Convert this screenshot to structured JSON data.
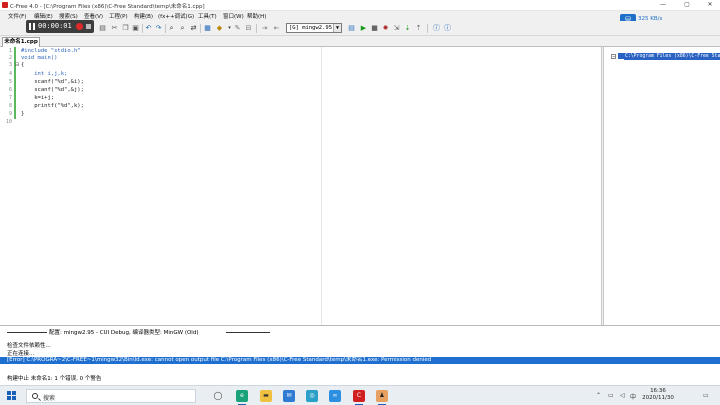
{
  "window": {
    "title": "C-Free 4.0 - [C:\\Program Files (x86)\\C-Free Standard\\temp\\未命名1.cpp]",
    "minimize": "—",
    "maximize": "▢",
    "close": "✕"
  },
  "recording": {
    "time": "00:00:01"
  },
  "network": {
    "speed": "325 KB/s"
  },
  "menu": [
    "文件(F)",
    "编辑(E)",
    "搜索(S)",
    "查看(V)",
    "工程(P)",
    "构建(B)",
    "(fx++调试(G)",
    "工具(T)",
    "窗口(W)",
    "帮助(H)"
  ],
  "toolbar": {
    "compiler": "[G] mingw2.95"
  },
  "tabs": [
    {
      "label": "未命名1.cpp"
    }
  ],
  "editor": {
    "line_numbers": [
      "1",
      "2",
      "3",
      "4",
      "5",
      "6",
      "7",
      "8",
      "9",
      "10"
    ],
    "code": [
      "#include \"stdio.h\"",
      "void main()",
      "{",
      "    int i,j,k;",
      "    scanf(\"%d\",&i);",
      "    scanf(\"%d\",&j);",
      "    k=i+j;",
      "    printf(\"%d\",k);",
      "}",
      ""
    ]
  },
  "project_tree": {
    "root": "C:\\Program Files (x86)\\C-Free Standard\\temp"
  },
  "output": {
    "header": "配置: mingw2.95 - CUI Debug, 编译器类型: MinGW (Old)",
    "lines": [
      "检查文件依赖性...",
      "正在连接..."
    ],
    "error": "[Error] C:\\PROGRA~2\\C-FREE~1\\mingw32\\Bin\\ld.exe: cannot open output file C:\\Program Files (x86)\\C-Free Standard\\temp\\未命名1.exe: Permission denied",
    "summary": "构建中止 未命名1: 1 个错误, 0 个警告"
  },
  "taskbar": {
    "search_placeholder": "搜索",
    "time": "16:36",
    "date": "2020/11/30",
    "ime": "中"
  },
  "colors": {
    "accent": "#1e6fd0",
    "change_bar": "#5cb85c",
    "recording_dot": "#e02828"
  }
}
